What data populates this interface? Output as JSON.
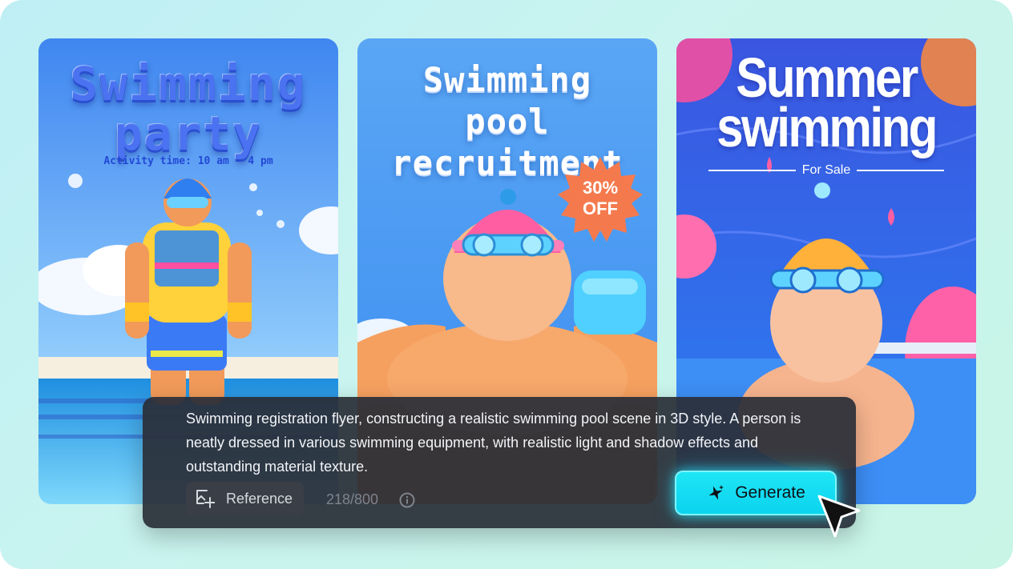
{
  "posters": [
    {
      "title_line1": "Swimming",
      "title_line2": "party",
      "subtitle": "Activity time: 10 am - 4 pm"
    },
    {
      "title_line1": "Swimming",
      "title_line2": "pool",
      "title_line3": "recruitment",
      "badge_line1": "30%",
      "badge_line2": "OFF"
    },
    {
      "title_line1": "Summer",
      "title_line2": "swimming",
      "tagline": "For Sale"
    }
  ],
  "prompt_panel": {
    "text": "Swimming registration flyer, constructing a realistic swimming pool scene in 3D style. A person is neatly dressed in various swimming equipment, with realistic light and shadow effects and outstanding material texture.",
    "reference_label": "Reference",
    "char_count": "218/800",
    "generate_label": "Generate"
  },
  "icons": [
    "image-add-icon",
    "info-icon",
    "sparkle-icon",
    "cursor-arrow-icon"
  ],
  "colors": {
    "accent": "#0bd3ee",
    "panel": "#2a2e38",
    "badge": "#f47a4e"
  }
}
